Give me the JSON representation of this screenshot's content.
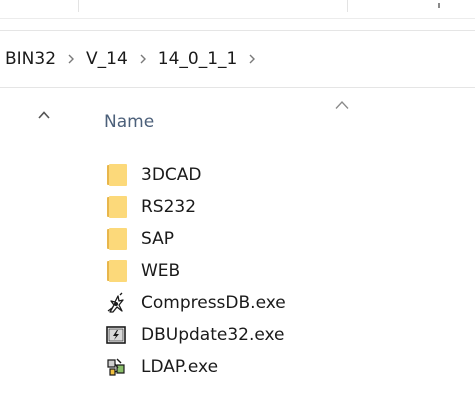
{
  "breadcrumb": {
    "items": [
      "BIN32",
      "V_14",
      "14_0_1_1"
    ],
    "separator": ">"
  },
  "nav": {
    "scroll_up_icon": "chevron-up-icon"
  },
  "columns": {
    "name_label": "Name",
    "sort_icon": "sort-ascending-icon"
  },
  "files": [
    {
      "name": "3DCAD",
      "type": "folder",
      "icon": "folder-icon"
    },
    {
      "name": "RS232",
      "type": "folder",
      "icon": "folder-icon"
    },
    {
      "name": "SAP",
      "type": "folder",
      "icon": "folder-icon"
    },
    {
      "name": "WEB",
      "type": "folder",
      "icon": "folder-icon"
    },
    {
      "name": "CompressDB.exe",
      "type": "exe",
      "icon": "compress-tool-icon"
    },
    {
      "name": "DBUpdate32.exe",
      "type": "exe",
      "icon": "db-update-icon"
    },
    {
      "name": "LDAP.exe",
      "type": "exe",
      "icon": "ldap-app-icon"
    }
  ],
  "colors": {
    "folder_front": "#fcd97a",
    "folder_back": "#e8b64b",
    "header_text": "#4c607a"
  }
}
